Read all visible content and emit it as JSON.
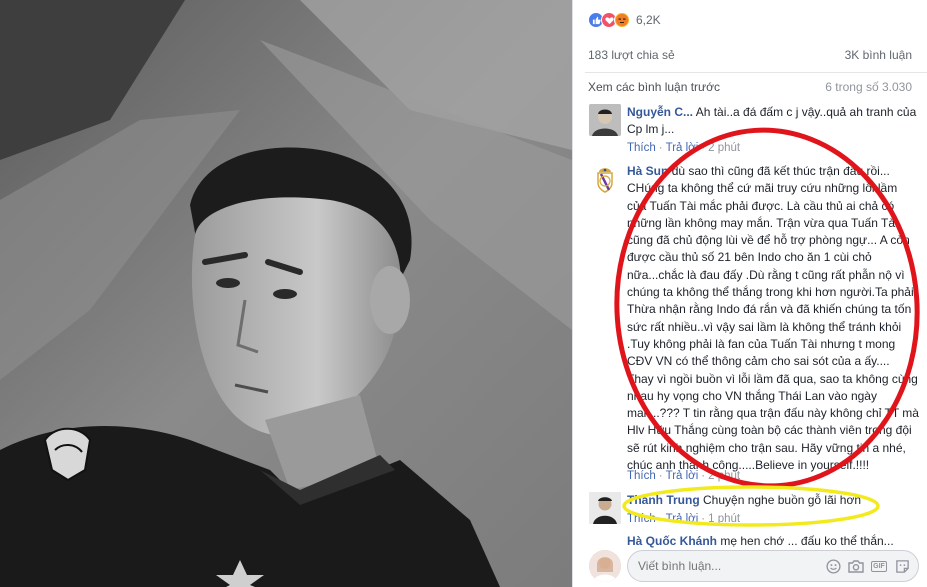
{
  "reactions": {
    "count": "6,2K",
    "icons": [
      "like-icon",
      "love-icon",
      "angry-icon"
    ]
  },
  "stats": {
    "shares": "183 lượt chia sẻ",
    "comments": "3K bình luận"
  },
  "previous": {
    "label": "Xem các bình luận trước",
    "count": "6 trong số 3.030"
  },
  "comments": [
    {
      "author": "Nguyễn C...",
      "text": "Ah tài..a đá đấm c j vậy..quả ah tranh của Cp lm j...",
      "like": "Thích",
      "reply": "Trả lời",
      "time": "2 phút"
    },
    {
      "author": "Hà Sun",
      "text": "dù sao thì cũng đã kết thúc trận đấu rồi... CHúng ta không thể cứ mãi truy cứu những lỗi lầm của Tuấn Tài mắc phải được. Là cầu thủ ai chả có những lần không may mắn. Trận vừa qua Tuấn Tài cũng đã chủ động lùi về để hỗ trợ phòng ngự... A còn được cầu thủ số 21 bên Indo cho ăn 1 cùi chỏ nữa...chắc là đau đấy .Dù rằng t cũng rất phẫn nộ vì chúng ta không thể thắng trong khi hơn người.Ta phải Thừa nhận rằng Indo đá rắn và đã khiến chúng ta tốn sức rất nhiều..vì vậy sai lầm là không thể tránh khỏi .Tuy không phải là fan của Tuấn Tài nhưng t mong CĐV VN có thể thông cảm cho sai sót của a ấy.... Thay vì ngồi buồn vì lỗi lầm đã qua, sao ta không cùng nhau hy vọng cho VN thắng Thái Lan vào ngày mai....??? T tin rằng qua trận đấu này không chỉ TT mà Hlv Hữu Thắng cùng toàn bộ các thành viên trong đội sẽ rút kinh nghiệm cho trận sau. Hãy vững tin a nhé, chúc anh thành công.....Believe in yourself.!!!!",
      "like": "Thích",
      "reply": "Trả lời",
      "time": "2 phút"
    },
    {
      "author": "Thanh Trung",
      "text": "Chuyện nghe buồn gỗ lãi hơn",
      "like": "Thích",
      "reply": "Trả lời",
      "time": "1 phút"
    },
    {
      "author": "Hà Quốc Khánh",
      "text": "mẹ hen chớ ... đấu ko thể thắn..."
    }
  ],
  "composer": {
    "placeholder": "Viết bình luận...",
    "icons": [
      "emoji-icon",
      "camera-icon",
      "gif-icon",
      "sticker-icon"
    ],
    "gif_label": "GIF"
  },
  "colors": {
    "link": "#365899",
    "action": "#4267b2",
    "muted": "#90949c",
    "red_annotation": "#e0141b",
    "yellow_annotation": "#f2ea1c"
  }
}
